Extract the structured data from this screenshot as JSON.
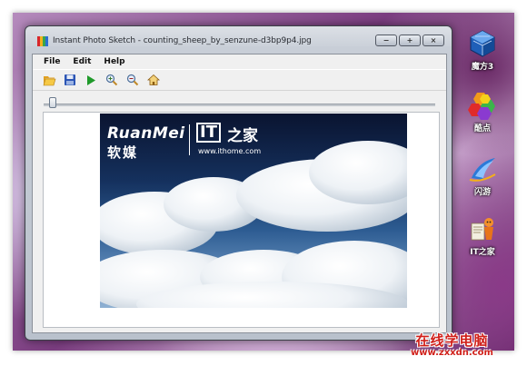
{
  "window": {
    "title": "Instant Photo Sketch - counting_sheep_by_senzune-d3bp9p4.jpg",
    "controls": {
      "minimize": "−",
      "maximize": "+",
      "close": "×"
    }
  },
  "menu": {
    "items": [
      "File",
      "Edit",
      "Help"
    ]
  },
  "toolbar": {
    "buttons": [
      {
        "icon": "open-folder-icon"
      },
      {
        "icon": "save-icon"
      },
      {
        "icon": "play-icon"
      },
      {
        "icon": "zoom-in-icon"
      },
      {
        "icon": "zoom-out-icon"
      },
      {
        "icon": "home-icon"
      }
    ]
  },
  "slider": {
    "value_fraction": 0.02
  },
  "photo": {
    "logo_ruanmei": "RuanMei",
    "logo_ruanmei_cn": "软媒",
    "logo_it": "IT",
    "logo_it_cn": "之家",
    "logo_url": "www.ithome.com"
  },
  "desktop": {
    "icons": [
      {
        "label": "魔方3",
        "icon": "mofang-cube-icon"
      },
      {
        "label": "酷点",
        "icon": "kudian-dots-icon"
      },
      {
        "label": "闪游",
        "icon": "shanyou-swoosh-icon"
      },
      {
        "label": "IT之家",
        "icon": "ithome-mascot-icon"
      }
    ]
  },
  "watermark": {
    "text_cn": "在线学电脑",
    "url": "www.zxxdn.com"
  },
  "colors": {
    "accent_red": "#d0201a",
    "titlebar": "#c9cfd8"
  }
}
